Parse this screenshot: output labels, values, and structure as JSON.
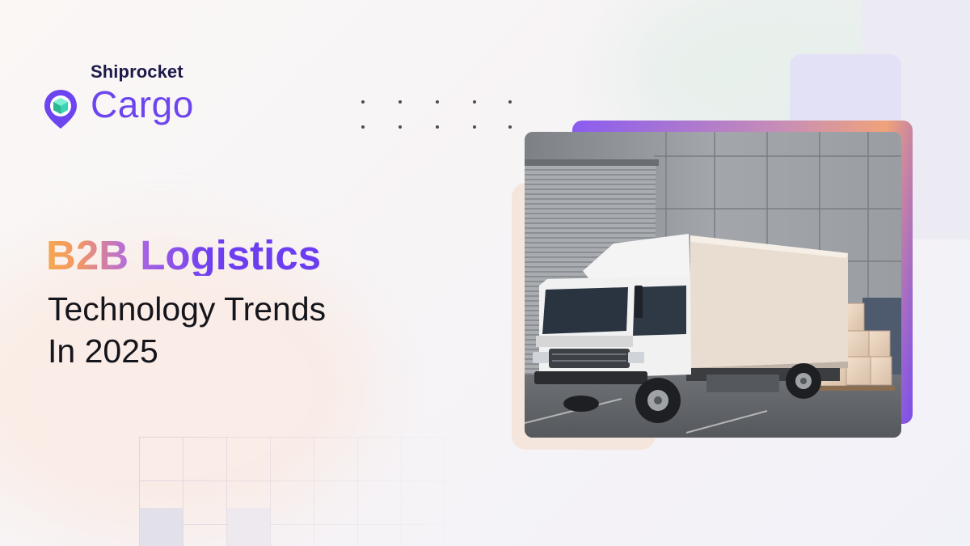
{
  "brand": {
    "company": "Shiprocket",
    "product": "Cargo",
    "icon": "location-pin-box-icon",
    "primary_color": "#6d45ef"
  },
  "headline": {
    "title": "B2B Logistics",
    "subtitle_line_1": "Technology Trends",
    "subtitle_line_2": "In 2025"
  },
  "image": {
    "subject": "white-delivery-truck-icon"
  },
  "colors": {
    "headline_gradient_start": "#f5a84f",
    "headline_gradient_end": "#6c3df0",
    "text_dark": "#15151c",
    "accent_peach": "#f4e6dc",
    "accent_lavender": "#e3e1f5"
  }
}
